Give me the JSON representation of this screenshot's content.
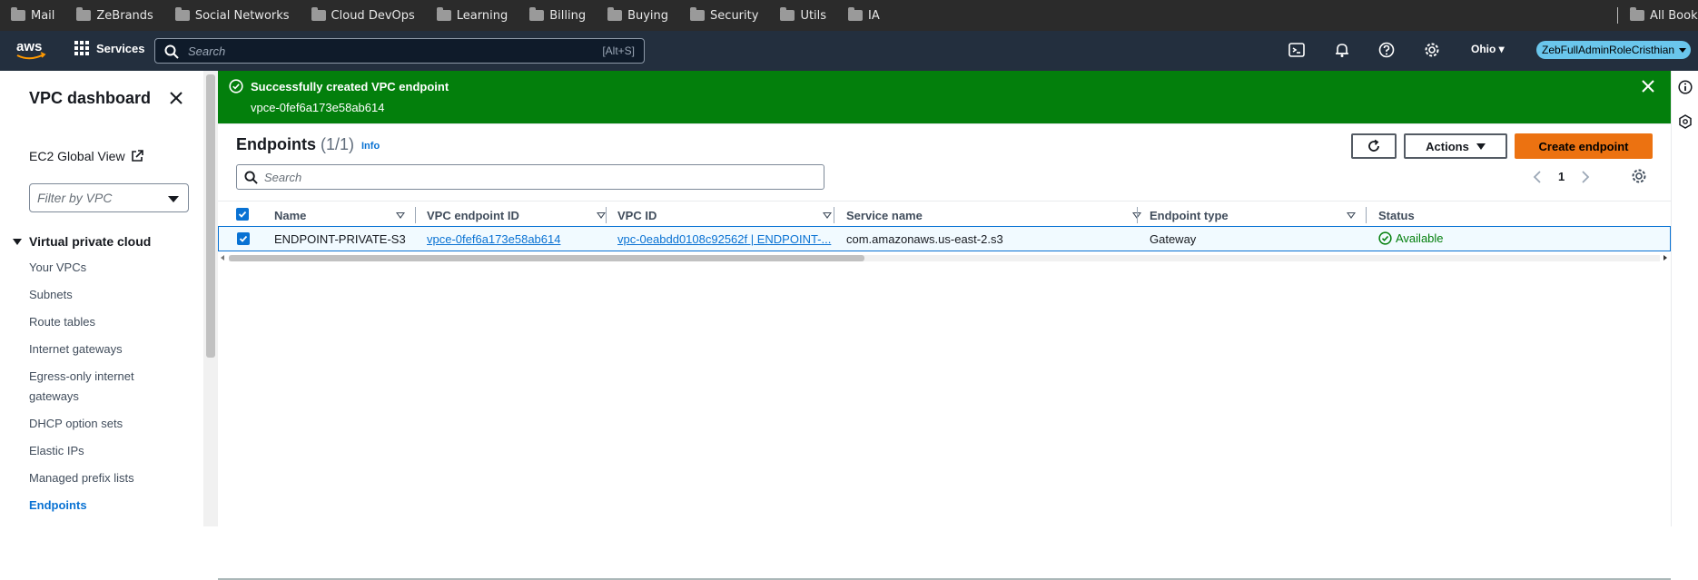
{
  "bookmarks": [
    "Mail",
    "ZeBrands",
    "Social Networks",
    "Cloud DevOps",
    "Learning",
    "Billing",
    "Buying",
    "Security",
    "Utils",
    "IA"
  ],
  "bookmarks_right": "All Book",
  "topnav": {
    "services_label": "Services",
    "search_placeholder": "Search",
    "search_shortcut": "[Alt+S]",
    "region": "Ohio",
    "role": "ZebFullAdminRoleCristhian"
  },
  "sidebar": {
    "title": "VPC dashboard",
    "ec2_global_view": "EC2 Global View",
    "filter_placeholder": "Filter by VPC",
    "section": "Virtual private cloud",
    "items": [
      {
        "label": "Your VPCs",
        "active": false
      },
      {
        "label": "Subnets",
        "active": false
      },
      {
        "label": "Route tables",
        "active": false
      },
      {
        "label": "Internet gateways",
        "active": false
      },
      {
        "label": "Egress-only internet gateways",
        "active": false
      },
      {
        "label": "DHCP option sets",
        "active": false
      },
      {
        "label": "Elastic IPs",
        "active": false
      },
      {
        "label": "Managed prefix lists",
        "active": false
      },
      {
        "label": "Endpoints",
        "active": true
      }
    ]
  },
  "flash": {
    "title": "Successfully created VPC endpoint",
    "detail": "vpce-0fef6a173e58ab614",
    "color": "#037f0c"
  },
  "endpoints": {
    "title": "Endpoints",
    "count": "(1/1)",
    "info": "Info",
    "actions_label": "Actions",
    "create_label": "Create endpoint",
    "search_placeholder": "Search",
    "page": "1",
    "columns": [
      "Name",
      "VPC endpoint ID",
      "VPC ID",
      "Service name",
      "Endpoint type",
      "Status"
    ],
    "rows": [
      {
        "name": "ENDPOINT-PRIVATE-S3",
        "endpoint_id": "vpce-0fef6a173e58ab614",
        "vpc_id": "vpc-0eabdd0108c92562f | ENDPOINT-...",
        "service_name": "com.amazonaws.us-east-2.s3",
        "endpoint_type": "Gateway",
        "status": "Available"
      }
    ]
  },
  "accent_color": "#0972d3",
  "primary_button_color": "#ec7211"
}
